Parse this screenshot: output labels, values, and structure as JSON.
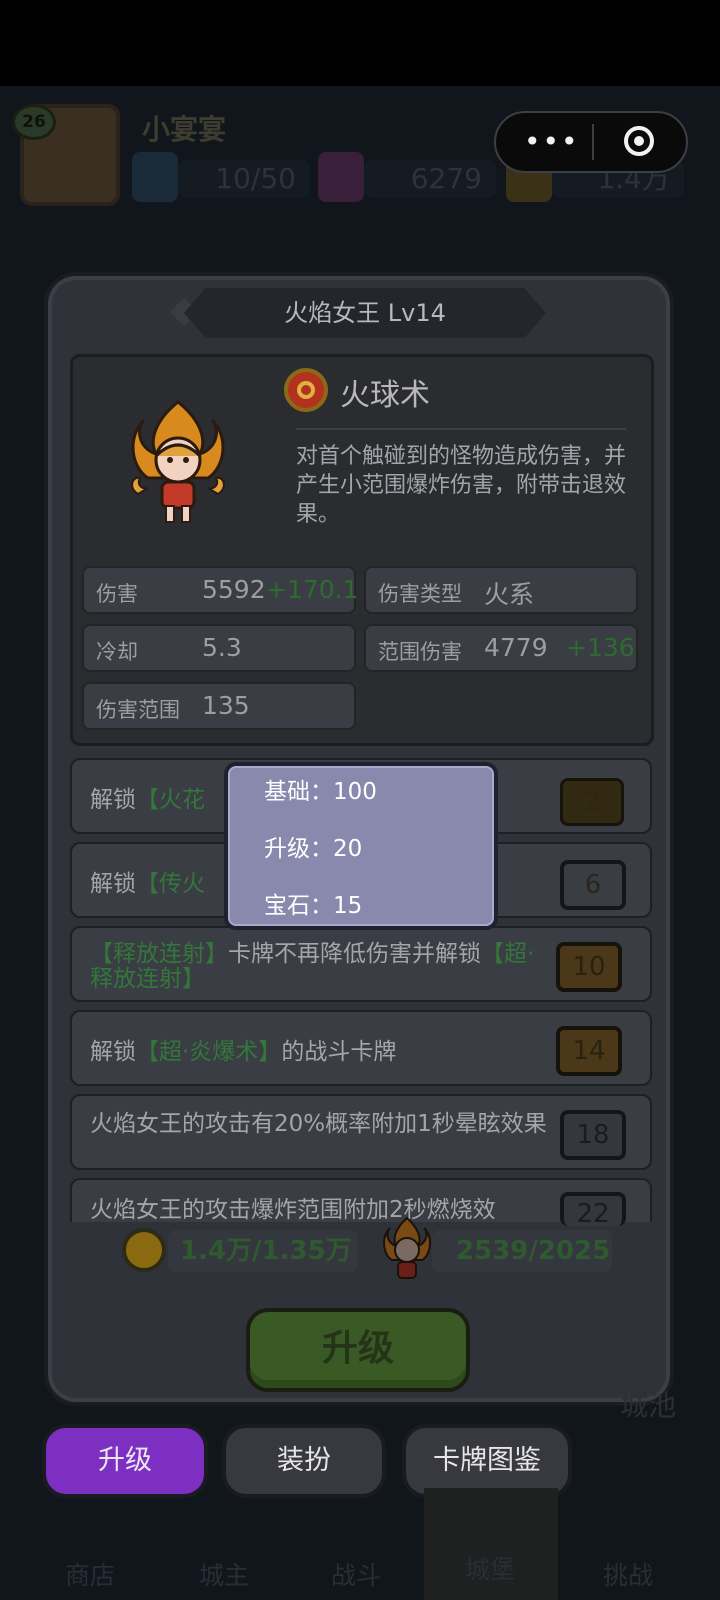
{
  "player": {
    "level": "26",
    "name": "小宴宴",
    "energy": "10/50",
    "gems": "6279",
    "gold": "1.4万"
  },
  "dialog": {
    "title": "火焰女王  Lv14",
    "skill": {
      "name": "火球术",
      "description": "对首个触碰到的怪物造成伤害，并产生小范围爆炸伤害，附带击退效果。"
    },
    "stats": {
      "damage_label": "伤害",
      "damage_value": "5592",
      "damage_bonus": "+170.1",
      "cooldown_label": "冷却",
      "cooldown_value": "5.3",
      "range_label": "伤害范围",
      "range_value": "135",
      "type_label": "伤害类型",
      "type_value": "火系",
      "area_label": "范围伤害",
      "area_value": "4779",
      "area_bonus": "+136"
    },
    "unlocks": [
      {
        "prefix": "解锁",
        "highlight": "【火花",
        "suffix": "",
        "level": "2"
      },
      {
        "prefix": "解锁",
        "highlight": "【传火",
        "suffix": "",
        "level": "6"
      },
      {
        "highlight1": "【释放连射】",
        "text": "卡牌不再降低伤害并解锁",
        "highlight2": "【超·释放连射】",
        "level": "10"
      },
      {
        "prefix": "解锁",
        "highlight": "【超·炎爆术】",
        "suffix": "的战斗卡牌",
        "level": "14"
      },
      {
        "text": "火焰女王的攻击有20%概率附加1秒晕眩效果",
        "level": "18"
      },
      {
        "text": "火焰女王的攻击爆炸范围附加2秒燃烧效",
        "level": "22"
      }
    ],
    "cost_gold": "1.4万/1.35万",
    "cost_shards": "2539/2025",
    "upgrade_button": "升级"
  },
  "popup": {
    "base": "基础：100",
    "upgrade": "升级：20",
    "gem": "宝石：15"
  },
  "tabs": [
    "升级",
    "装扮",
    "卡牌图鉴"
  ],
  "side_label": "城池",
  "nav": [
    "商店",
    "城主",
    "战斗",
    "城堡",
    "挑战"
  ]
}
